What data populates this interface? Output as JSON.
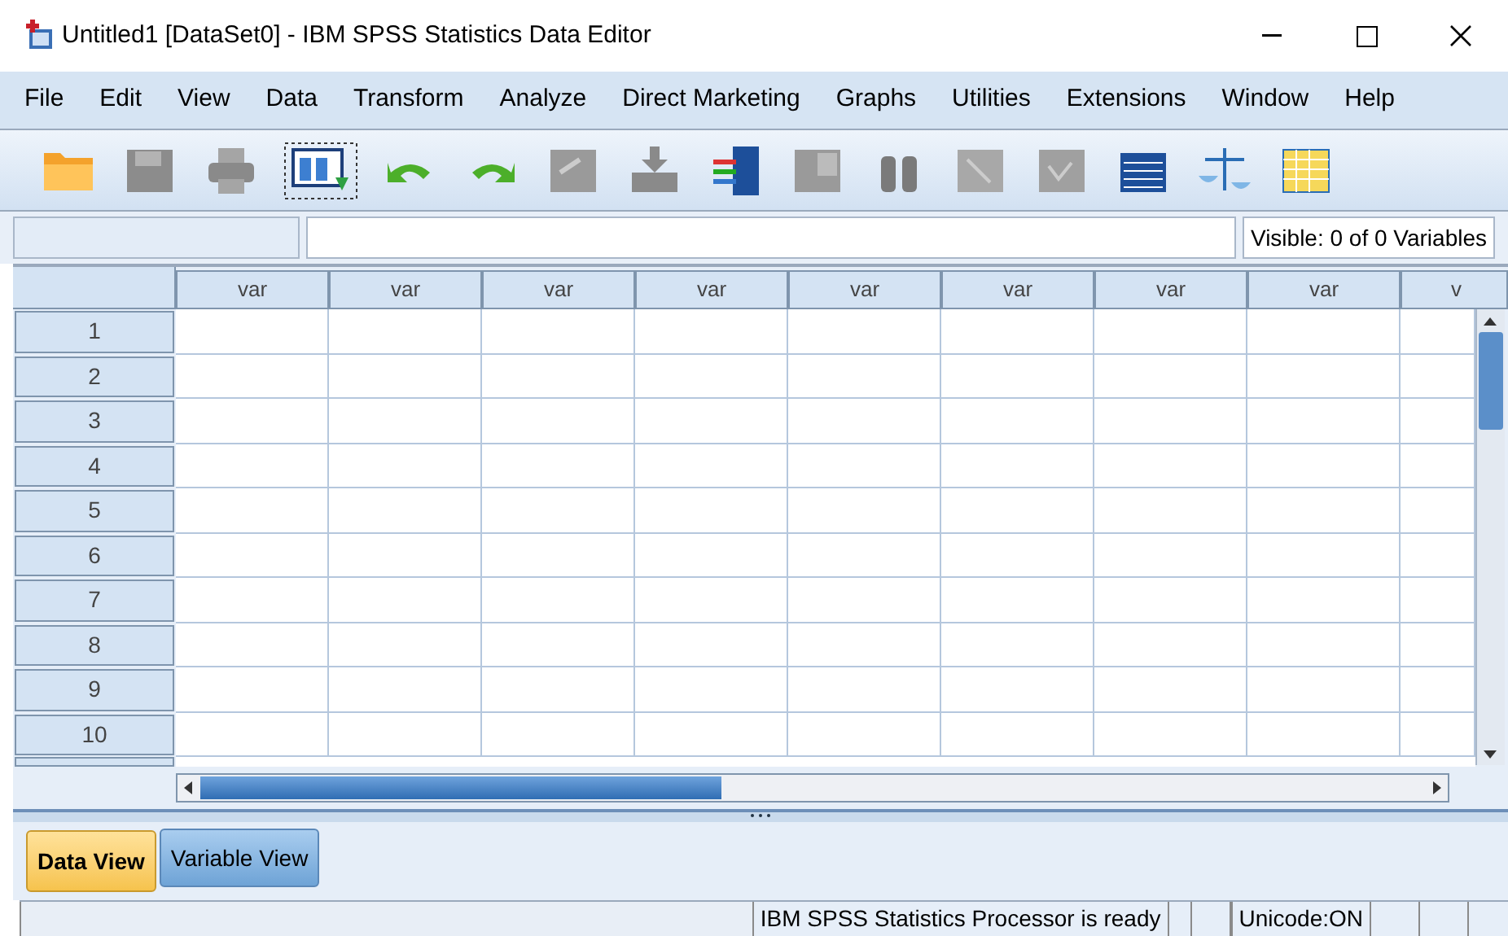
{
  "window": {
    "title": "Untitled1 [DataSet0] - IBM SPSS Statistics Data Editor"
  },
  "menu": [
    "File",
    "Edit",
    "View",
    "Data",
    "Transform",
    "Analyze",
    "Direct Marketing",
    "Graphs",
    "Utilities",
    "Extensions",
    "Window",
    "Help"
  ],
  "visible_info": "Visible: 0 of 0 Variables",
  "grid": {
    "columns": [
      "var",
      "var",
      "var",
      "var",
      "var",
      "var",
      "var",
      "var",
      "v"
    ],
    "rows": [
      "1",
      "2",
      "3",
      "4",
      "5",
      "6",
      "7",
      "8",
      "9",
      "10"
    ]
  },
  "tabs": [
    {
      "label": "Data View",
      "selected": true
    },
    {
      "label": "Variable View",
      "selected": false
    }
  ],
  "status_bar": {
    "processor": "IBM SPSS Statistics Processor is ready",
    "unicode": "Unicode:ON"
  }
}
